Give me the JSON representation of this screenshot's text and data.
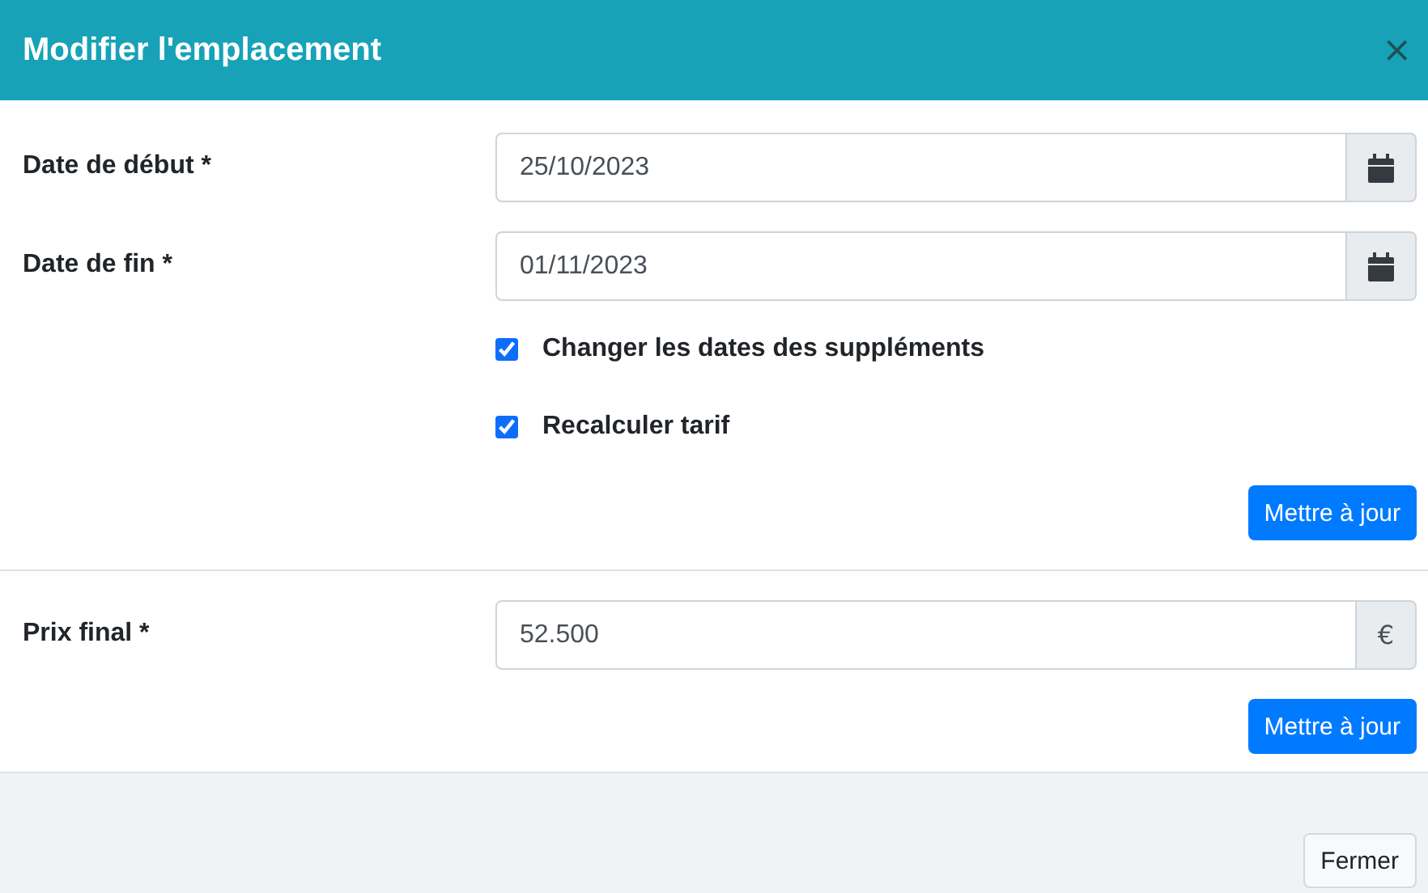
{
  "window": {
    "title": "Modifier l'emplacement",
    "close": "×"
  },
  "body": [
    {
      "kind": "field",
      "label": "Date de début *",
      "value": "25/10/2023",
      "addon": {
        "kind": "calendar"
      }
    },
    {
      "kind": "field",
      "label": "Date de fin *",
      "value": "01/11/2023",
      "addon": {
        "kind": "calendar"
      }
    },
    {
      "kind": "checkbox",
      "label": "Changer les dates des suppléments",
      "checked": true
    },
    {
      "kind": "checkbox",
      "label": "Recalculer tarif",
      "checked": true
    },
    {
      "kind": "button",
      "label": "Mettre à jour"
    },
    {
      "kind": "divider"
    },
    {
      "kind": "field",
      "label": "Prix final *",
      "value": "52.500",
      "addon": {
        "kind": "text",
        "text": "€"
      }
    },
    {
      "kind": "button",
      "label": "Mettre à jour"
    }
  ],
  "footer": {
    "buttons": [
      "Fermer"
    ]
  }
}
